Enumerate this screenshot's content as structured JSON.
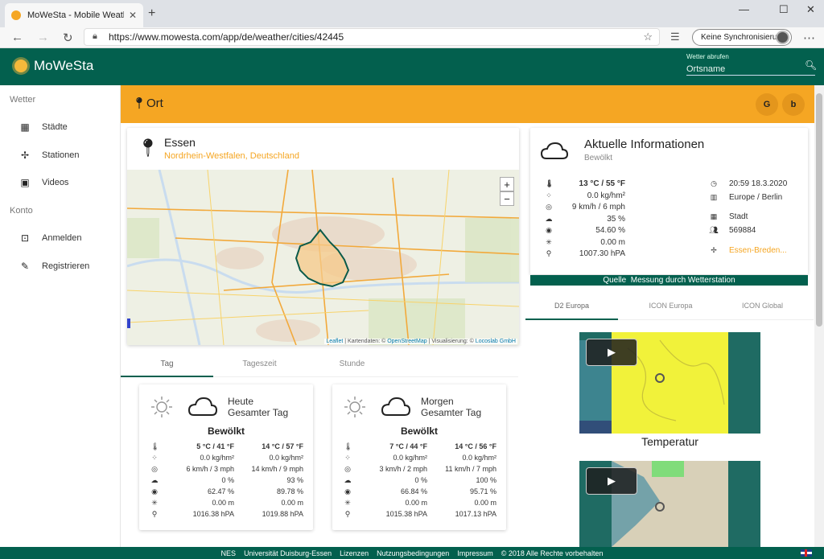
{
  "browser": {
    "tab_title": "MoWeSta - Mobile Weather Stat",
    "url": "https://www.mowesta.com/app/de/weather/cities/42445",
    "sync_label": "Keine Synchronisierung"
  },
  "header": {
    "brand": "MoWeSta",
    "search_label": "Wetter abrufen",
    "search_placeholder": "Ortsname"
  },
  "sidebar": {
    "section_weather": "Wetter",
    "section_account": "Konto",
    "items": [
      {
        "label": "Städte",
        "icon": "city-icon"
      },
      {
        "label": "Stationen",
        "icon": "fan-icon"
      },
      {
        "label": "Videos",
        "icon": "video-icon"
      },
      {
        "label": "Anmelden",
        "icon": "login-icon"
      },
      {
        "label": "Registrieren",
        "icon": "pencil-icon"
      }
    ]
  },
  "location_bar": {
    "label": "Ort",
    "btn_google": "G",
    "btn_bing": "b"
  },
  "city": {
    "name": "Essen",
    "region": "Nordrhein-Westfalen, Deutschland"
  },
  "map": {
    "zoom_in": "+",
    "zoom_out": "−",
    "labels": [
      "Ham",
      "Uedem",
      "Xanten",
      "Wesel",
      "Dorsten",
      "Haltern am See",
      "Dülmen",
      "Lüdinghausen",
      "Marl",
      "Recklinghausen",
      "Werne",
      "Gladbeck",
      "Kevelaer",
      "Bottrop",
      "Herne",
      "Dortmund",
      "Geldern",
      "Kamp-Lintfort",
      "Unna",
      "Bochum",
      "Witten",
      "Schwerte",
      "Moers",
      "Essen",
      "Menden",
      "Straelen",
      "Iserlohn",
      "Velbert",
      "Herdecke",
      "Venlo",
      "Sprockhövel",
      "Hemer",
      "Hagen",
      "Krefeld",
      "Grefrath",
      "Heiligenhaus",
      "Altena",
      "Lobberich",
      "Nevige",
      "Balve",
      "Wuppertal",
      "Viersen",
      "Breckerfeld",
      "Düsseldorf",
      "Waldniel",
      "Mettmann",
      "Plettenberg",
      "Werden"
    ],
    "roads": [
      "A3",
      "A31",
      "A52",
      "A43",
      "A2",
      "A1",
      "A57",
      "A59",
      "A40",
      "A52",
      "A3"
    ],
    "attribution_leaflet": "Leaflet",
    "attribution_text": "| Kartendaten: © ",
    "attribution_osm": "OpenStreetMap",
    "attribution_vis": "| Visualisierung: © ",
    "attribution_locoslab": "Locoslab GmbH"
  },
  "day_tabs": [
    "Tag",
    "Tageszeit",
    "Stunde"
  ],
  "days": [
    {
      "title1": "Heute",
      "title2": "Gesamter Tag",
      "condition": "Bewölkt",
      "rows": [
        [
          "5 °C / 41 °F",
          "14 °C / 57 °F"
        ],
        [
          "0.0 kg/hm²",
          "0.0 kg/hm²"
        ],
        [
          "6 km/h / 3 mph",
          "14 km/h / 9 mph"
        ],
        [
          "0 %",
          "93 %"
        ],
        [
          "62.47 %",
          "89.78 %"
        ],
        [
          "0.00 m",
          "0.00 m"
        ],
        [
          "1016.38 hPA",
          "1019.88 hPA"
        ]
      ]
    },
    {
      "title1": "Morgen",
      "title2": "Gesamter Tag",
      "condition": "Bewölkt",
      "rows": [
        [
          "7 °C / 44 °F",
          "14 °C / 56 °F"
        ],
        [
          "0.0 kg/hm²",
          "0.0 kg/hm²"
        ],
        [
          "3 km/h / 2 mph",
          "11 km/h / 7 mph"
        ],
        [
          "0 %",
          "100 %"
        ],
        [
          "66.84 %",
          "95.71 %"
        ],
        [
          "0.00 m",
          "0.00 m"
        ],
        [
          "1015.38 hPA",
          "1017.13 hPA"
        ]
      ]
    }
  ],
  "current": {
    "title": "Aktuelle Informationen",
    "condition": "Bewölkt",
    "values": [
      "13 °C / 55 °F",
      "0.0 kg/hm²",
      "9 km/h / 6 mph",
      "35 %",
      "54.60 %",
      "0.00 m",
      "1007.30 hPA"
    ],
    "time": "20:59 18.3.2020",
    "timezone": "Europe / Berlin",
    "type": "Stadt",
    "population": "569884",
    "station": "Essen-Breden...",
    "source_label": "Quelle",
    "source_value": "Messung durch Wetterstation"
  },
  "model_tabs": [
    "D2 Europa",
    "ICON Europa",
    "ICON Global"
  ],
  "video": {
    "label": "Temperatur"
  },
  "footer": [
    "NES",
    "Universität Duisburg-Essen",
    "Lizenzen",
    "Nutzungsbedingungen",
    "Impressum",
    "© 2018 Alle Rechte vorbehalten"
  ],
  "colors": {
    "primary": "#03604e",
    "accent": "#f5a623"
  }
}
